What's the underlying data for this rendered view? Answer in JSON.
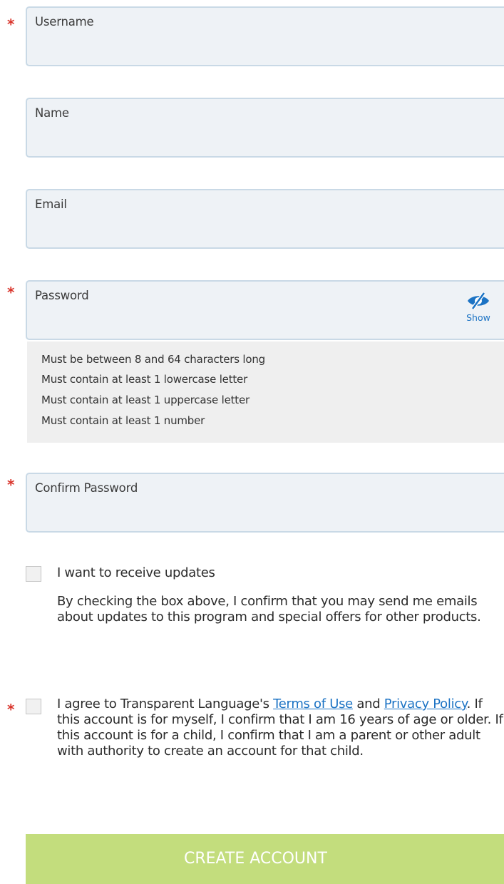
{
  "form": {
    "required_marker": "*",
    "username": {
      "label": "Username",
      "value": ""
    },
    "name": {
      "label": "Name",
      "value": ""
    },
    "email": {
      "label": "Email",
      "value": ""
    },
    "password": {
      "label": "Password",
      "value": "",
      "show_label": "Show",
      "show_icon": "eye-slash-icon"
    },
    "password_rules": [
      "Must be between 8 and 64 characters long",
      "Must contain at least 1 lowercase letter",
      "Must contain at least 1 uppercase letter",
      "Must contain at least 1 number"
    ],
    "confirm_password": {
      "label": "Confirm Password",
      "value": ""
    },
    "updates": {
      "label": "I want to receive updates",
      "checked": false,
      "description": "By checking the box above, I confirm that you may send me emails about updates to this program and special offers for other products."
    },
    "terms": {
      "checked": false,
      "text_before": "I agree to Transparent Language's ",
      "terms_link": "Terms of Use",
      "text_between": " and ",
      "privacy_link": "Privacy Policy",
      "text_after": ". If this account is for myself, I confirm that I am 16 years of age or older. If this account is for a child, I confirm that I am a parent or other adult with authority to create an account for that child."
    },
    "submit_label": "CREATE ACCOUNT"
  },
  "colors": {
    "accent_link": "#1c73c4",
    "required": "#d9342b",
    "button_bg": "#c3dd7d",
    "field_bg": "#eef2f6",
    "field_border": "#c9d9e6"
  }
}
